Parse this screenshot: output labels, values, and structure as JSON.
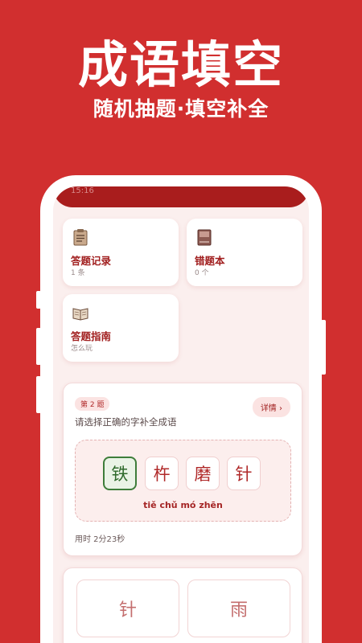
{
  "hero": {
    "title": "成语填空",
    "subtitle": "随机抽题·填空补全"
  },
  "status_bar": {
    "time": "15:16"
  },
  "tiles": [
    {
      "title": "答题记录",
      "subtitle": "1 条",
      "icon": "clipboard-icon"
    },
    {
      "title": "错题本",
      "subtitle": "0 个",
      "icon": "book-icon"
    },
    {
      "title": "答题指南",
      "subtitle": "怎么玩",
      "icon": "open-book-icon"
    }
  ],
  "question": {
    "badge": "第 2 题",
    "detail_label": "详情 ›",
    "prompt": "请选择正确的字补全成语",
    "chars": [
      "铁",
      "杵",
      "磨",
      "针"
    ],
    "selected_index": 0,
    "pinyin": "tiě chǔ mó zhēn",
    "timer": "用时 2分23秒"
  },
  "options": [
    "针",
    "雨"
  ],
  "colors": {
    "background": "#d12f2f",
    "accent": "#a11f1f",
    "selected": "#3e7d3a"
  }
}
